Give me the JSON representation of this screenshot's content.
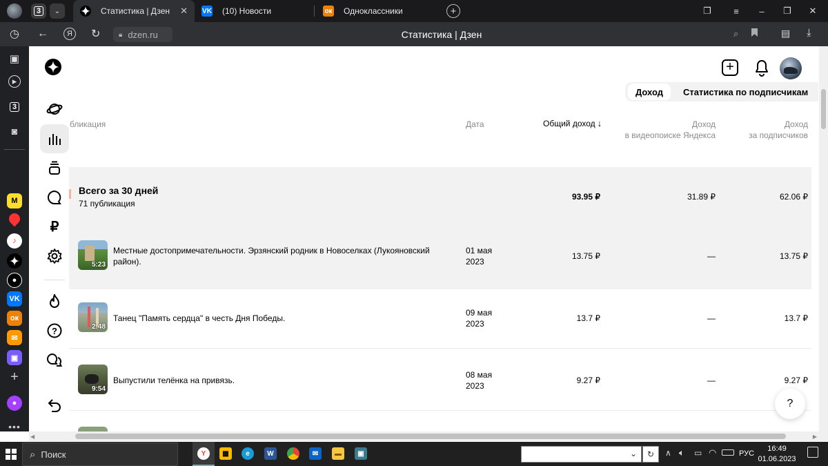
{
  "browser": {
    "tab_counter": "3",
    "tabs": [
      {
        "title": "Статистика | Дзен"
      },
      {
        "title": "(10) Новости"
      },
      {
        "title": "Одноклассники"
      }
    ],
    "domain": "dzen.ru",
    "page_title": "Статистика | Дзен",
    "sidebar_counter": "3"
  },
  "page": {
    "segments": {
      "income": "Доход",
      "subscribers": "Статистика по подписчикам"
    },
    "columns": {
      "publication": "бликация",
      "date": "Дата",
      "total": "Общий доход",
      "video_1": "Доход",
      "video_2": "в видеопоиске Яндекса",
      "subs_1": "Доход",
      "subs_2": "за подписчиков"
    },
    "summary": {
      "title": "Всего за 30 дней",
      "subtitle": "71 публикация",
      "total": "93.95 ₽",
      "video": "31.89 ₽",
      "subs": "62.06 ₽"
    },
    "rows": [
      {
        "title": "Местные достопримечательности. Эрзянский родник в Новоселках (Лукояновский район).",
        "duration": "5:23",
        "date_1": "01 мая",
        "date_2": "2023",
        "total": "13.75 ₽",
        "video": "—",
        "subs": "13.75 ₽"
      },
      {
        "title": "Танец \"Память сердца\" в честь Дня Победы.",
        "duration": "2:48",
        "date_1": "09 мая",
        "date_2": "2023",
        "total": "13.7 ₽",
        "video": "—",
        "subs": "13.7 ₽"
      },
      {
        "title": "Выпустили телёнка на привязь.",
        "duration": "9:54",
        "date_1": "08 мая",
        "date_2": "2023",
        "total": "9.27 ₽",
        "video": "—",
        "subs": "9.27 ₽"
      }
    ],
    "help": "?"
  },
  "taskbar": {
    "search": "Поиск",
    "lang": "РУС",
    "time": "16:49",
    "date": "01.06.2023"
  }
}
